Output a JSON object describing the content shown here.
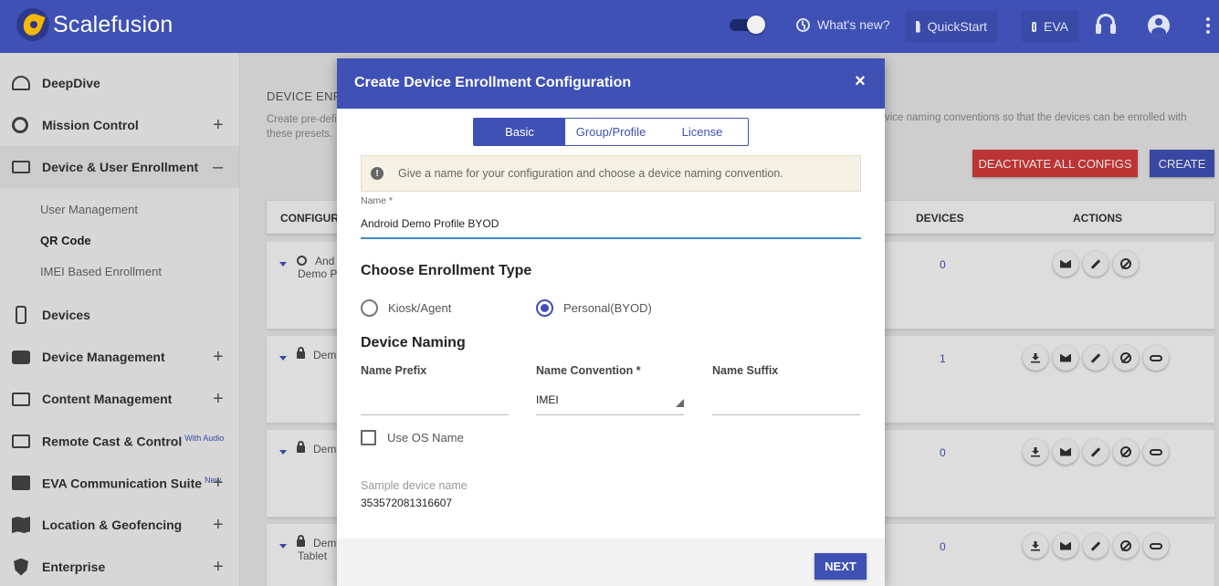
{
  "app": {
    "brand": "Scalefusion"
  },
  "topbar": {
    "whats_new": "What's new?",
    "quickstart": "QuickStart",
    "eva": "EVA"
  },
  "sidebar": {
    "items": [
      {
        "label": "DeepDive",
        "icon": "gauge-icon"
      },
      {
        "label": "Mission Control",
        "icon": "disc-icon",
        "expand": "+"
      },
      {
        "label": "Device & User Enrollment",
        "icon": "devices-icon",
        "expand": "–"
      },
      {
        "label": "Devices",
        "icon": "phone-icon"
      },
      {
        "label": "Device Management",
        "icon": "briefcase-icon",
        "expand": "+"
      },
      {
        "label": "Content Management",
        "icon": "folder-icon",
        "expand": "+"
      },
      {
        "label": "Remote Cast & Control",
        "badge": "With Audio",
        "icon": "cast-icon"
      },
      {
        "label": "EVA Communication Suite",
        "badge": "New",
        "icon": "chat-icon",
        "expand": "+"
      },
      {
        "label": "Location & Geofencing",
        "icon": "map-icon",
        "expand": "+"
      },
      {
        "label": "Enterprise",
        "icon": "shield-icon",
        "expand": "+"
      }
    ],
    "subitems": [
      "User Management",
      "QR Code",
      "IMEI Based Enrollment"
    ]
  },
  "main": {
    "title": "DEVICE ENR",
    "desc": "Create pre-defi\nthese presets.",
    "desc_right": "vice naming conventions so that the devices can be enrolled with",
    "deactivate_button": "DEACTIVATE ALL CONFIGS",
    "create_button": "CREATE",
    "table": {
      "headers": [
        "CONFIGURA",
        "DEVICES",
        "ACTIONS"
      ],
      "rows": [
        {
          "name_line1": "And",
          "name_line2": "Demo P",
          "devices": "0"
        },
        {
          "name_line1": "Dem",
          "name_line2": "",
          "devices": "1"
        },
        {
          "name_line1": "Dem",
          "name_line2": "",
          "devices": "0"
        },
        {
          "name_line1": "Dem",
          "name_line2": "Tablet",
          "devices": "0"
        }
      ]
    }
  },
  "modal": {
    "title": "Create Device Enrollment Configuration",
    "close": "×",
    "tabs": [
      "Basic",
      "Group/Profile",
      "License"
    ],
    "info": "Give a name for your configuration and choose a device naming convention.",
    "name_label": "Name *",
    "name_value": "Android Demo Profile BYOD",
    "enrollment_title": "Choose Enrollment Type",
    "enrollment_options": [
      "Kiosk/Agent",
      "Personal(BYOD)"
    ],
    "enrollment_selected": "Personal(BYOD)",
    "naming_title": "Device Naming",
    "prefix_label": "Name Prefix",
    "convention_label": "Name Convention *",
    "convention_value": "IMEI",
    "suffix_label": "Name Suffix",
    "use_os_label": "Use OS Name",
    "sample_label": "Sample device name",
    "sample_value": "353572081316607",
    "next_button": "NEXT"
  }
}
